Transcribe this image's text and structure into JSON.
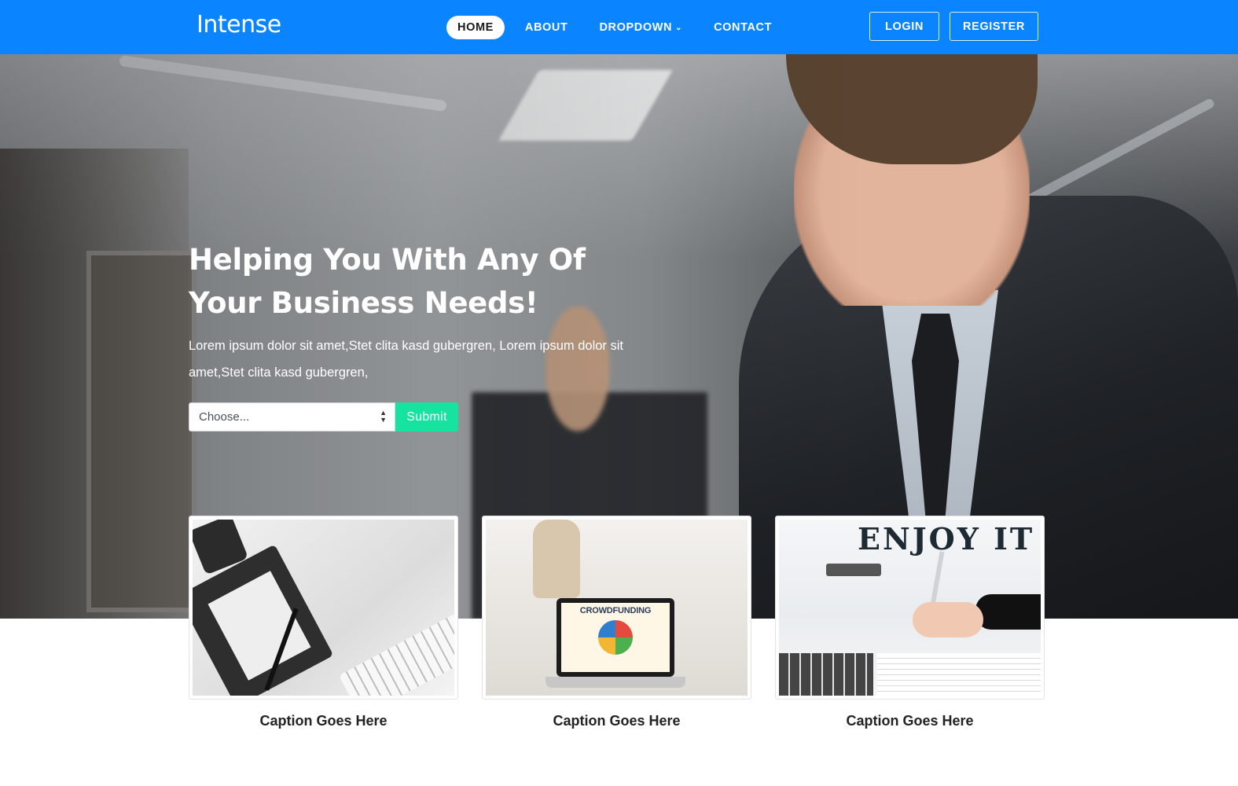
{
  "nav": {
    "brand": "Intense",
    "links": [
      {
        "label": "HOME"
      },
      {
        "label": "ABOUT"
      },
      {
        "label": "DROPDOWN"
      },
      {
        "label": "CONTACT"
      }
    ],
    "login_label": "LOGIN",
    "register_label": "REGISTER",
    "accent_color": "#0a84ff"
  },
  "hero": {
    "title_line1": "Helping You With Any Of",
    "title_line2": "Your Business Needs!",
    "text": "Lorem ipsum dolor sit amet,Stet clita kasd gubergren, Lorem ipsum dolor sit amet,Stet clita kasd gubergren,",
    "select_value": "Choose...",
    "submit_label": "Submit",
    "submit_color": "#17e3a0"
  },
  "cards": [
    {
      "caption": "Caption Goes Here"
    },
    {
      "caption": "Caption Goes Here",
      "screen_text": "CROWDFUNDING"
    },
    {
      "caption": "Caption Goes Here",
      "sign_text": "ENJOY IT"
    }
  ]
}
